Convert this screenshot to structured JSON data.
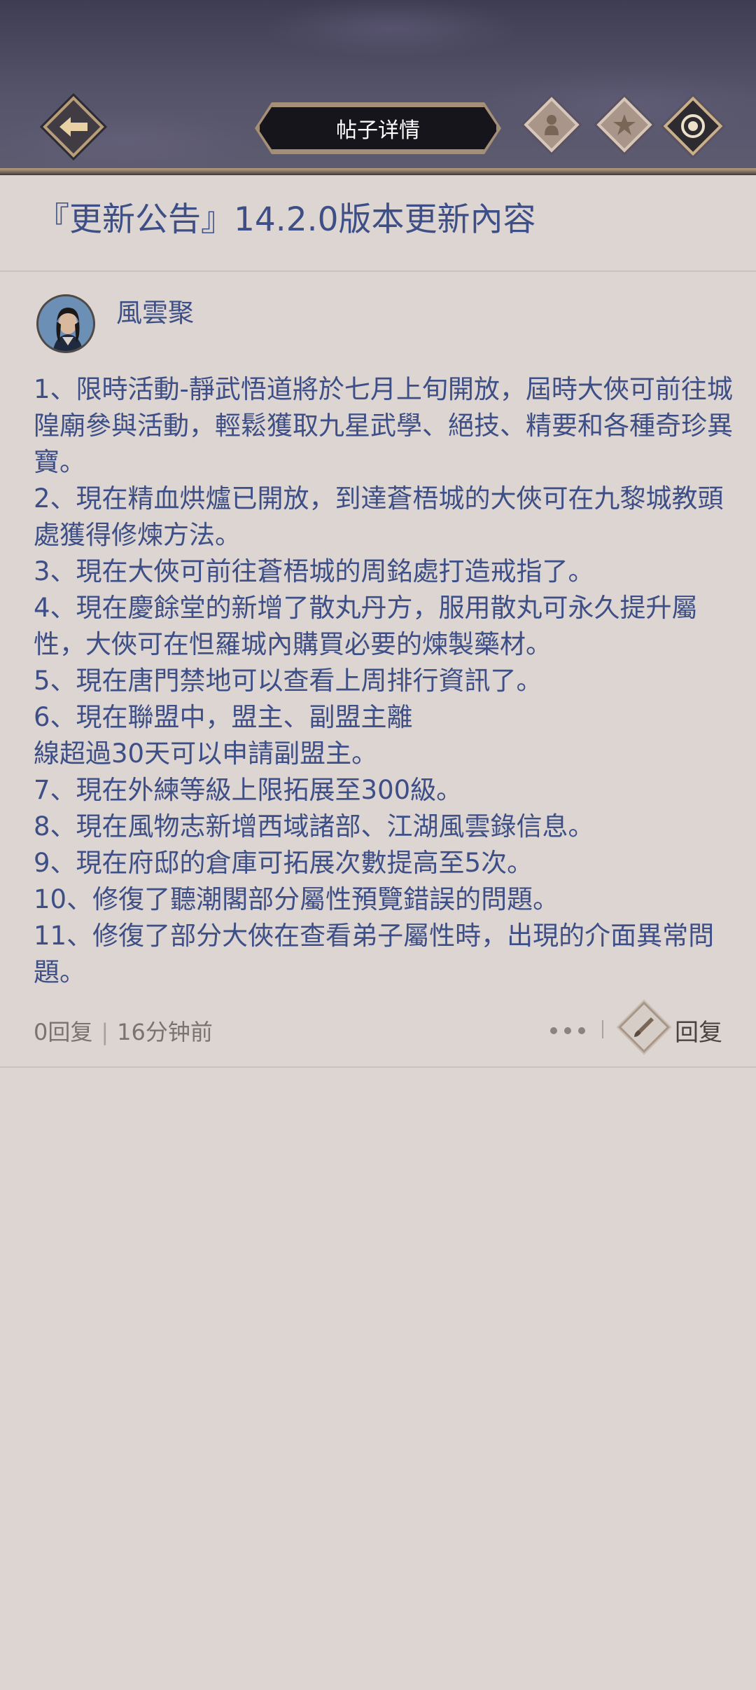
{
  "header": {
    "title": "帖子详情",
    "back_icon": "back-arrow-icon",
    "icons": [
      "author-icon",
      "star-icon",
      "target-icon"
    ]
  },
  "post": {
    "title": "『更新公告』14.2.0版本更新內容",
    "author": "風雲聚",
    "lines": [
      "1、限時活動-靜武悟道將於七月上旬開放，屆時大俠可前往城隍廟參與活動，輕鬆獲取九星武學、絕技、精要和各種奇珍異寶。",
      "2、現在精血烘爐已開放，到達蒼梧城的大俠可在九黎城教頭處獲得修煉方法。",
      "3、現在大俠可前往蒼梧城的周銘處打造戒指了。",
      "4、現在慶餘堂的新增了散丸丹方，服用散丸可永久提升屬性，大俠可在怛羅城內購買必要的煉製藥材。",
      "5、現在唐門禁地可以查看上周排行資訊了。",
      "6、現在聯盟中，盟主、副盟主離",
      "線超過30天可以申請副盟主。",
      "7、現在外練等級上限拓展至300級。",
      "8、現在風物志新增西域諸部、江湖風雲錄信息。",
      "9、現在府邸的倉庫可拓展次數提高至5次。",
      "10、修復了聽潮閣部分屬性預覽錯誤的問題。",
      "11、修復了部分大俠在查看弟子屬性時，出現的介面異常問題。"
    ],
    "reply_count": "0回复",
    "separator": "|",
    "time": "16分钟前",
    "reply_label": "回复"
  },
  "colors": {
    "text_blue": "#3d4f86",
    "background": "#dcd5d1",
    "header_dark": "#3e3d52"
  }
}
